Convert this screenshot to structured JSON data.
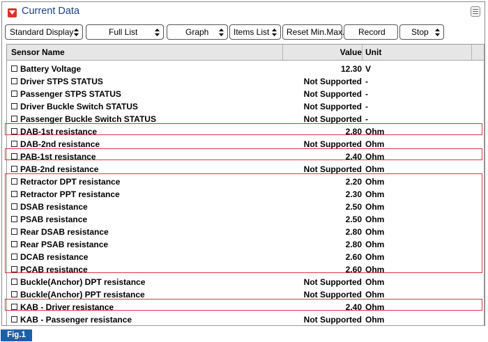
{
  "window": {
    "title": "Current Data"
  },
  "toolbar": {
    "standard_display": "Standard Display",
    "full_list": "Full List",
    "graph": "Graph",
    "items_list": "Items List",
    "reset_minmax": "Reset Min.Max.",
    "record": "Record",
    "stop": "Stop"
  },
  "table": {
    "headers": {
      "name": "Sensor Name",
      "value": "Value",
      "unit": "Unit"
    },
    "rows": [
      {
        "name": "Battery Voltage",
        "value": "12.30",
        "unit": "V"
      },
      {
        "name": "Driver STPS STATUS",
        "value": "Not Supported",
        "unit": "-"
      },
      {
        "name": "Passenger STPS STATUS",
        "value": "Not Supported",
        "unit": "-"
      },
      {
        "name": "Driver Buckle Switch STATUS",
        "value": "Not Supported",
        "unit": "-"
      },
      {
        "name": "Passenger Buckle Switch STATUS",
        "value": "Not Supported",
        "unit": "-"
      },
      {
        "name": "DAB-1st resistance",
        "value": "2.80",
        "unit": "Ohm"
      },
      {
        "name": "DAB-2nd resistance",
        "value": "Not Supported",
        "unit": "Ohm"
      },
      {
        "name": "PAB-1st resistance",
        "value": "2.40",
        "unit": "Ohm"
      },
      {
        "name": "PAB-2nd resistance",
        "value": "Not Supported",
        "unit": "Ohm"
      },
      {
        "name": "Retractor DPT resistance",
        "value": "2.20",
        "unit": "Ohm"
      },
      {
        "name": "Retractor PPT resistance",
        "value": "2.30",
        "unit": "Ohm"
      },
      {
        "name": "DSAB resistance",
        "value": "2.50",
        "unit": "Ohm"
      },
      {
        "name": "PSAB resistance",
        "value": "2.50",
        "unit": "Ohm"
      },
      {
        "name": "Rear DSAB resistance",
        "value": "2.80",
        "unit": "Ohm"
      },
      {
        "name": "Rear PSAB resistance",
        "value": "2.80",
        "unit": "Ohm"
      },
      {
        "name": "DCAB resistance",
        "value": "2.60",
        "unit": "Ohm"
      },
      {
        "name": "PCAB resistance",
        "value": "2.60",
        "unit": "Ohm"
      },
      {
        "name": "Buckle(Anchor) DPT resistance",
        "value": "Not Supported",
        "unit": "Ohm"
      },
      {
        "name": "Buckle(Anchor) PPT resistance",
        "value": "Not Supported",
        "unit": "Ohm"
      },
      {
        "name": "KAB - Driver resistance",
        "value": "2.40",
        "unit": "Ohm"
      },
      {
        "name": "KAB - Passenger resistance",
        "value": "Not Supported",
        "unit": "Ohm"
      }
    ]
  },
  "figure_label": "Fig.1",
  "colors": {
    "highlight": "#e0333f",
    "title": "#1f3f7a",
    "fig_badge": "#1d5fa6",
    "title_icon": "#d9322b"
  },
  "icons": {
    "title": "caret-down-icon",
    "menu": "menu-icon",
    "dropdown": "up-down-arrow-icon",
    "row": "checkbox-icon"
  }
}
